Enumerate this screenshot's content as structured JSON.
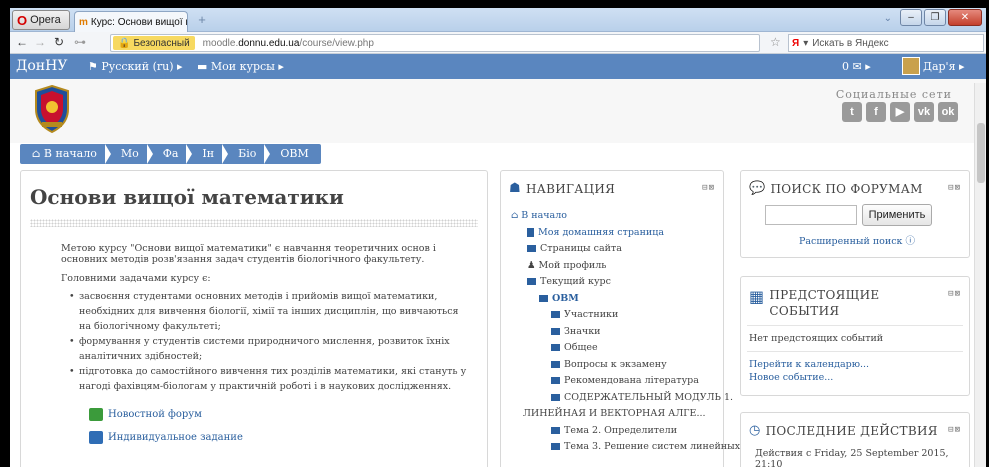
{
  "browser": {
    "opera_label": "Opera",
    "tab_title": "Курс: Основи вищої м...",
    "tab_close": "×",
    "secure_label": "Безопасный",
    "url_prefix": "moodle.",
    "url_domain": "donnu.edu.ua",
    "url_path": "/course/view.php",
    "search_placeholder": "Искать в Яндекс"
  },
  "moodle_nav": {
    "brand": "ДонНУ",
    "language": "Русский (ru) ▸",
    "my_courses": "Мои курсы ▸",
    "messages": "0 ✉ ▸",
    "user": "Дар'я ▸"
  },
  "header": {
    "social_title": "Социальные сети",
    "social_icons": [
      "twitter-icon",
      "facebook-icon",
      "youtube-icon",
      "vk-icon",
      "odnoklassniki-icon"
    ]
  },
  "breadcrumb": [
    "В начало",
    "Мо",
    "Фа",
    "Ін",
    "Біо",
    "ОВМ"
  ],
  "course": {
    "title": "Основи вищої математики",
    "summary": "Метою курсу \"Основи вищої математики\" є навчання теоретичних основ і основних методів розв'язання задач студентів біологічного факультету.",
    "tasks_heading": "Головними задачами курсу є:",
    "tasks": [
      "засвоєння студентами основних методів і прийомів вищої математики, необхідних для вивчення біології, хімії та інших дисциплін, що вивчаються на біологічному факультеті;",
      "формування у студентів системи природничого мислення, розвиток їхніх аналітичних здібностей;",
      "підготовка до самостійного вивчення тих розділів математики, які стануть у нагоді фахівцям-біологам у практичній роботі і в наукових дослідженнях."
    ],
    "activities": [
      "Новостной форум",
      "Индивидуальное задание"
    ]
  },
  "navigation_block": {
    "title": "Навигация",
    "items": [
      "В начало",
      "Моя домашняя страница",
      "Страницы сайта",
      "Мой профиль",
      "Текущий курс",
      "ОВМ",
      "Участники",
      "Значки",
      "Общее",
      "Вопросы к экзамену",
      "Рекомендована література",
      "СОДЕРЖАТЕЛЬНЫЙ МОДУЛЬ 1.",
      "ЛИНЕЙНАЯ И ВЕКТОРНАЯ АЛГЕ...",
      "Тема 2. Определители",
      "Тема 3. Решение систем линейных"
    ]
  },
  "forum_search_block": {
    "title": "Поиск по форумам",
    "button": "Применить",
    "advanced": "Расширенный поиск"
  },
  "upcoming_block": {
    "title_line1": "Предстоящие",
    "title_line2": "события",
    "empty": "Нет предстоящих событий",
    "goto_calendar": "Перейти к календарю...",
    "new_event": "Новое событие..."
  },
  "recent_block": {
    "title": "Последние действия",
    "since": "Действия с Friday, 25 September 2015, 21:10"
  },
  "colors": {
    "nav_blue": "#5a86bf",
    "link_blue": "#2a5f9e"
  }
}
